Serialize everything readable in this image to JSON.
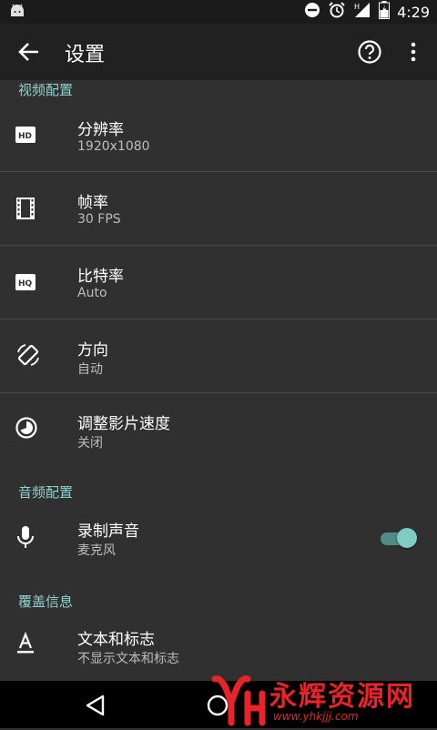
{
  "status_bar": {
    "time": "4:29"
  },
  "app_bar": {
    "title": "设置"
  },
  "sections": [
    {
      "header": "视频配置",
      "items": [
        {
          "title": "分辨率",
          "subtitle": "1920x1080",
          "icon": "hd-icon"
        },
        {
          "title": "帧率",
          "subtitle": "30 FPS",
          "icon": "film-icon"
        },
        {
          "title": "比特率",
          "subtitle": "Auto",
          "icon": "hq-icon"
        },
        {
          "title": "方向",
          "subtitle": "自动",
          "icon": "screen-rotation-icon"
        },
        {
          "title": "调整影片速度",
          "subtitle": "关闭",
          "icon": "speed-icon"
        }
      ]
    },
    {
      "header": "音频配置",
      "items": [
        {
          "title": "录制声音",
          "subtitle": "麦克风",
          "icon": "microphone-icon",
          "toggle_on": true
        }
      ]
    },
    {
      "header": "覆盖信息",
      "items": [
        {
          "title": "文本和标志",
          "subtitle": "不显示文本和标志",
          "icon": "text-format-icon"
        }
      ]
    }
  ],
  "watermark": {
    "text": "永辉资源网",
    "url": "www.yhkjjj.com"
  },
  "colors": {
    "accent": "#80cbc4",
    "background": "#303030",
    "appbar": "#212121",
    "statusbar": "#1b1b1b"
  }
}
